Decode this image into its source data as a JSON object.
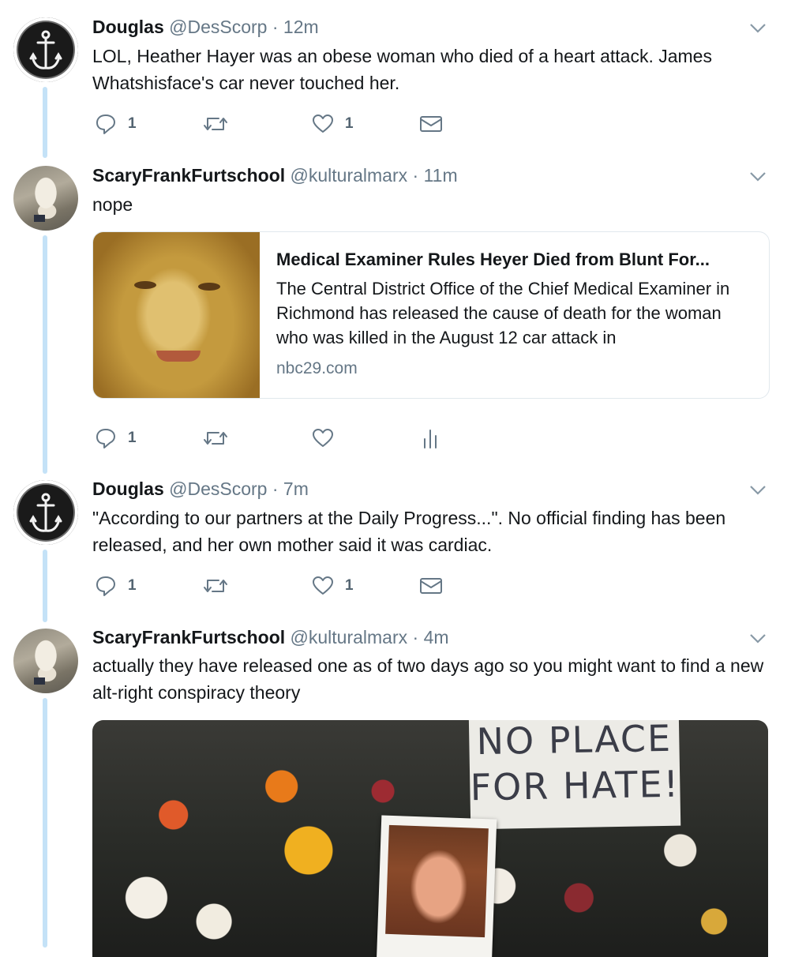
{
  "tweets": [
    {
      "name": "Douglas",
      "handle": "@DesScorp",
      "sep": "·",
      "time": "12m",
      "avatar": "anchor-avatar",
      "text": "LOL, Heather Hayer was an obese woman who died of a heart attack. James Whatshisface's car never touched her.",
      "reply_count": "1",
      "like_count": "1",
      "third_icon": "envelope-icon"
    },
    {
      "name": "ScaryFrankFurtschool",
      "handle": "@kulturalmarx",
      "sep": "·",
      "time": "11m",
      "avatar": "dog-avatar",
      "text": "nope",
      "card": {
        "title": "Medical Examiner Rules Heyer Died from Blunt For...",
        "description": "The Central District Office of the Chief Medical Examiner in Richmond has released the cause of death for the woman who was killed in the August 12 car attack in",
        "domain": "nbc29.com"
      },
      "reply_count": "1",
      "like_count": "",
      "third_icon": "analytics-icon"
    },
    {
      "name": "Douglas",
      "handle": "@DesScorp",
      "sep": "·",
      "time": "7m",
      "avatar": "anchor-avatar",
      "text": "\"According to our partners at the Daily Progress...\". No official finding has been released, and her own mother said it was cardiac.",
      "reply_count": "1",
      "like_count": "1",
      "third_icon": "envelope-icon"
    },
    {
      "name": "ScaryFrankFurtschool",
      "handle": "@kulturalmarx",
      "sep": "·",
      "time": "4m",
      "avatar": "dog-avatar",
      "text": "actually they have released one as of two days ago so you might want to find a new alt-right conspiracy theory",
      "media": {
        "sign_text_line1": "NO PLACE",
        "sign_text_line2": "FOR HATE!"
      }
    }
  ],
  "colors": {
    "thread_line": "#c4e2f7",
    "secondary_text": "#657786",
    "primary_text": "#14171a",
    "card_border": "#e1e8ed"
  }
}
